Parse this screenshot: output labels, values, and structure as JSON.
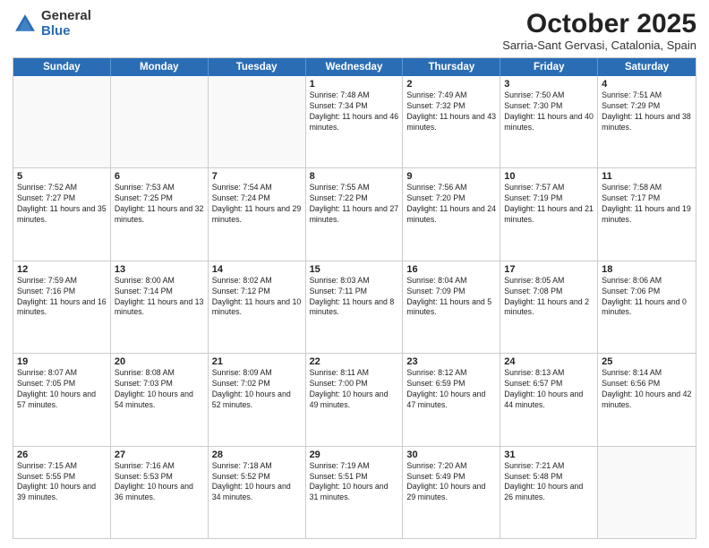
{
  "logo": {
    "general": "General",
    "blue": "Blue"
  },
  "header": {
    "month": "October 2025",
    "location": "Sarria-Sant Gervasi, Catalonia, Spain"
  },
  "weekdays": [
    "Sunday",
    "Monday",
    "Tuesday",
    "Wednesday",
    "Thursday",
    "Friday",
    "Saturday"
  ],
  "weeks": [
    [
      {
        "day": "",
        "text": "",
        "empty": true
      },
      {
        "day": "",
        "text": "",
        "empty": true
      },
      {
        "day": "",
        "text": "",
        "empty": true
      },
      {
        "day": "1",
        "text": "Sunrise: 7:48 AM\nSunset: 7:34 PM\nDaylight: 11 hours and 46 minutes."
      },
      {
        "day": "2",
        "text": "Sunrise: 7:49 AM\nSunset: 7:32 PM\nDaylight: 11 hours and 43 minutes."
      },
      {
        "day": "3",
        "text": "Sunrise: 7:50 AM\nSunset: 7:30 PM\nDaylight: 11 hours and 40 minutes."
      },
      {
        "day": "4",
        "text": "Sunrise: 7:51 AM\nSunset: 7:29 PM\nDaylight: 11 hours and 38 minutes."
      }
    ],
    [
      {
        "day": "5",
        "text": "Sunrise: 7:52 AM\nSunset: 7:27 PM\nDaylight: 11 hours and 35 minutes."
      },
      {
        "day": "6",
        "text": "Sunrise: 7:53 AM\nSunset: 7:25 PM\nDaylight: 11 hours and 32 minutes."
      },
      {
        "day": "7",
        "text": "Sunrise: 7:54 AM\nSunset: 7:24 PM\nDaylight: 11 hours and 29 minutes."
      },
      {
        "day": "8",
        "text": "Sunrise: 7:55 AM\nSunset: 7:22 PM\nDaylight: 11 hours and 27 minutes."
      },
      {
        "day": "9",
        "text": "Sunrise: 7:56 AM\nSunset: 7:20 PM\nDaylight: 11 hours and 24 minutes."
      },
      {
        "day": "10",
        "text": "Sunrise: 7:57 AM\nSunset: 7:19 PM\nDaylight: 11 hours and 21 minutes."
      },
      {
        "day": "11",
        "text": "Sunrise: 7:58 AM\nSunset: 7:17 PM\nDaylight: 11 hours and 19 minutes."
      }
    ],
    [
      {
        "day": "12",
        "text": "Sunrise: 7:59 AM\nSunset: 7:16 PM\nDaylight: 11 hours and 16 minutes."
      },
      {
        "day": "13",
        "text": "Sunrise: 8:00 AM\nSunset: 7:14 PM\nDaylight: 11 hours and 13 minutes."
      },
      {
        "day": "14",
        "text": "Sunrise: 8:02 AM\nSunset: 7:12 PM\nDaylight: 11 hours and 10 minutes."
      },
      {
        "day": "15",
        "text": "Sunrise: 8:03 AM\nSunset: 7:11 PM\nDaylight: 11 hours and 8 minutes."
      },
      {
        "day": "16",
        "text": "Sunrise: 8:04 AM\nSunset: 7:09 PM\nDaylight: 11 hours and 5 minutes."
      },
      {
        "day": "17",
        "text": "Sunrise: 8:05 AM\nSunset: 7:08 PM\nDaylight: 11 hours and 2 minutes."
      },
      {
        "day": "18",
        "text": "Sunrise: 8:06 AM\nSunset: 7:06 PM\nDaylight: 11 hours and 0 minutes."
      }
    ],
    [
      {
        "day": "19",
        "text": "Sunrise: 8:07 AM\nSunset: 7:05 PM\nDaylight: 10 hours and 57 minutes."
      },
      {
        "day": "20",
        "text": "Sunrise: 8:08 AM\nSunset: 7:03 PM\nDaylight: 10 hours and 54 minutes."
      },
      {
        "day": "21",
        "text": "Sunrise: 8:09 AM\nSunset: 7:02 PM\nDaylight: 10 hours and 52 minutes."
      },
      {
        "day": "22",
        "text": "Sunrise: 8:11 AM\nSunset: 7:00 PM\nDaylight: 10 hours and 49 minutes."
      },
      {
        "day": "23",
        "text": "Sunrise: 8:12 AM\nSunset: 6:59 PM\nDaylight: 10 hours and 47 minutes."
      },
      {
        "day": "24",
        "text": "Sunrise: 8:13 AM\nSunset: 6:57 PM\nDaylight: 10 hours and 44 minutes."
      },
      {
        "day": "25",
        "text": "Sunrise: 8:14 AM\nSunset: 6:56 PM\nDaylight: 10 hours and 42 minutes."
      }
    ],
    [
      {
        "day": "26",
        "text": "Sunrise: 7:15 AM\nSunset: 5:55 PM\nDaylight: 10 hours and 39 minutes."
      },
      {
        "day": "27",
        "text": "Sunrise: 7:16 AM\nSunset: 5:53 PM\nDaylight: 10 hours and 36 minutes."
      },
      {
        "day": "28",
        "text": "Sunrise: 7:18 AM\nSunset: 5:52 PM\nDaylight: 10 hours and 34 minutes."
      },
      {
        "day": "29",
        "text": "Sunrise: 7:19 AM\nSunset: 5:51 PM\nDaylight: 10 hours and 31 minutes."
      },
      {
        "day": "30",
        "text": "Sunrise: 7:20 AM\nSunset: 5:49 PM\nDaylight: 10 hours and 29 minutes."
      },
      {
        "day": "31",
        "text": "Sunrise: 7:21 AM\nSunset: 5:48 PM\nDaylight: 10 hours and 26 minutes."
      },
      {
        "day": "",
        "text": "",
        "empty": true
      }
    ]
  ]
}
